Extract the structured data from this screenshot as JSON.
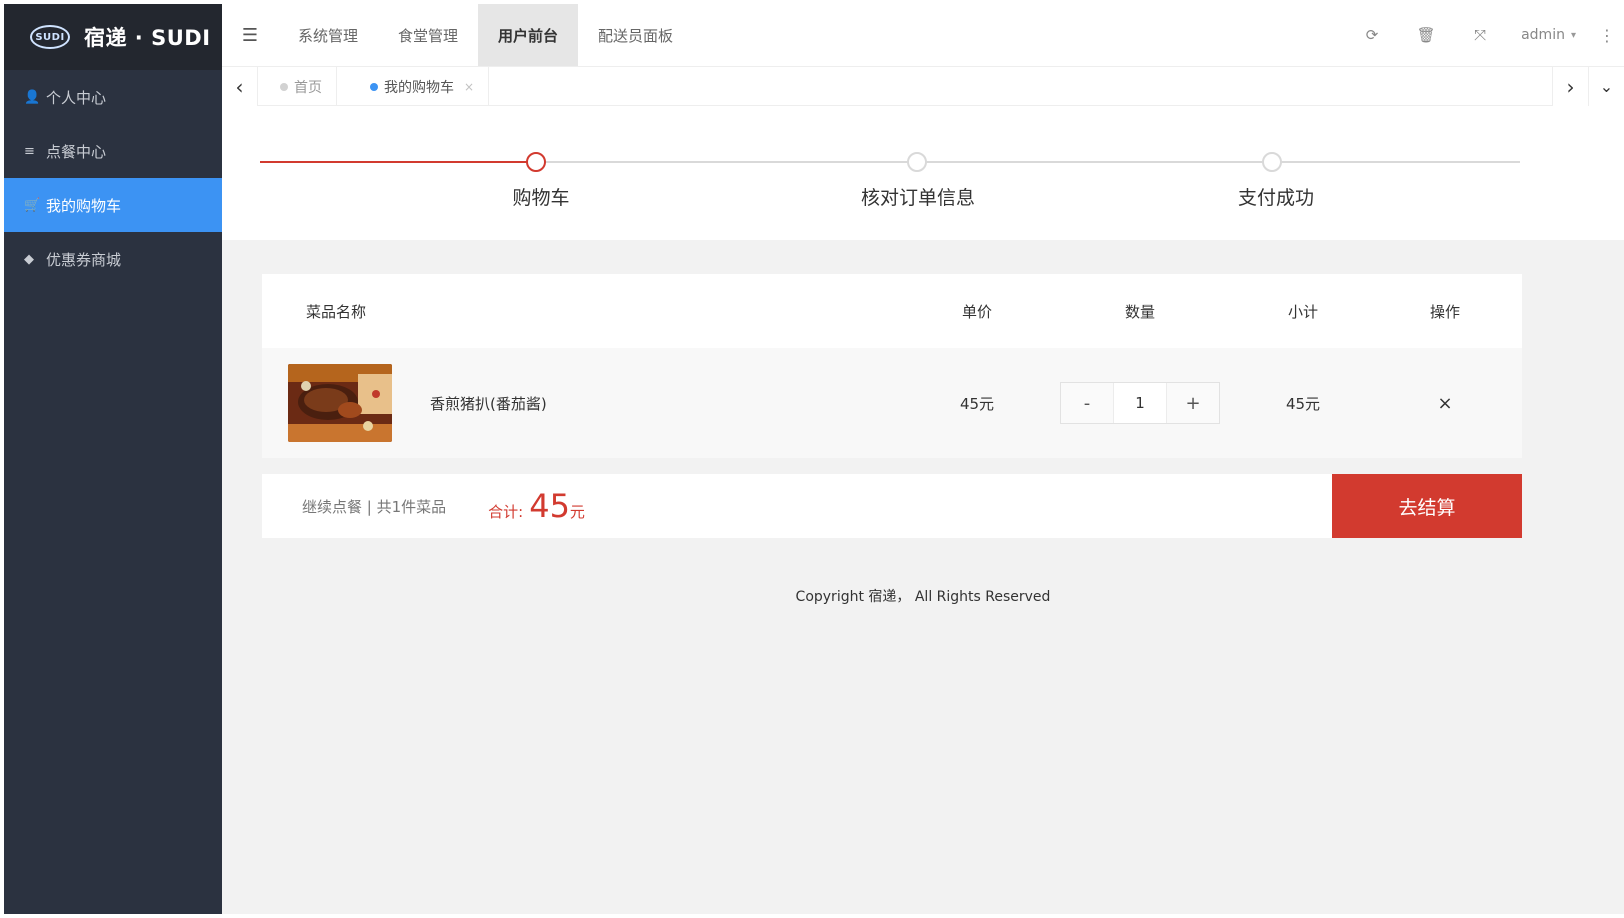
{
  "brand": {
    "badge": "SUDI",
    "name": "宿递 · SUDI"
  },
  "sidebar": {
    "items": [
      {
        "label": "个人中心",
        "icon": "user-icon",
        "glyph": "👤",
        "active": false
      },
      {
        "label": "点餐中心",
        "icon": "food-icon",
        "glyph": "≡",
        "active": false
      },
      {
        "label": "我的购物车",
        "icon": "cart-icon",
        "glyph": "🛒",
        "active": true
      },
      {
        "label": "优惠券商城",
        "icon": "tag-icon",
        "glyph": "◆",
        "active": false
      }
    ]
  },
  "header": {
    "menu_toggle_glyph": "☰",
    "tabs": [
      {
        "label": "系统管理",
        "active": false
      },
      {
        "label": "食堂管理",
        "active": false
      },
      {
        "label": "用户前台",
        "active": true
      },
      {
        "label": "配送员面板",
        "active": false
      }
    ],
    "tools": {
      "refresh_glyph": "⟳",
      "clear_glyph": "🗑",
      "fullscreen_glyph": "⤧"
    },
    "user": "admin",
    "user_caret": "▾",
    "more_glyph": "⋮"
  },
  "tabstrip": {
    "left_arrow": "‹",
    "right_arrow": "›",
    "down_arrow": "⌄",
    "tabs": [
      {
        "label": "首页",
        "active": false
      },
      {
        "label": "我的购物车",
        "active": true,
        "close": "×"
      }
    ]
  },
  "steps": {
    "items": [
      {
        "label": "购物车",
        "active": true
      },
      {
        "label": "核对订单信息",
        "active": false
      },
      {
        "label": "支付成功",
        "active": false
      }
    ],
    "active_color": "#d23a2f",
    "inactive_color": "#d9d9d9"
  },
  "cart": {
    "headers": {
      "name": "菜品名称",
      "price": "单价",
      "qty": "数量",
      "subtotal": "小计",
      "op": "操作"
    },
    "items": [
      {
        "name": "香煎猪扒(番茄酱)",
        "price": "45元",
        "qty": "1",
        "subtotal": "45元",
        "minus": "-",
        "plus": "+",
        "remove": "×"
      }
    ],
    "footer": {
      "continue": "继续点餐 | 共1件菜品",
      "total_label": "合计:",
      "total_value": "45",
      "total_unit": "元",
      "checkout": "去结算"
    }
  },
  "copyright": "Copyright 宿递， All Rights Reserved",
  "colors": {
    "accent": "#3c93f3",
    "danger": "#d23a2f",
    "sidebar": "#2b3240"
  }
}
